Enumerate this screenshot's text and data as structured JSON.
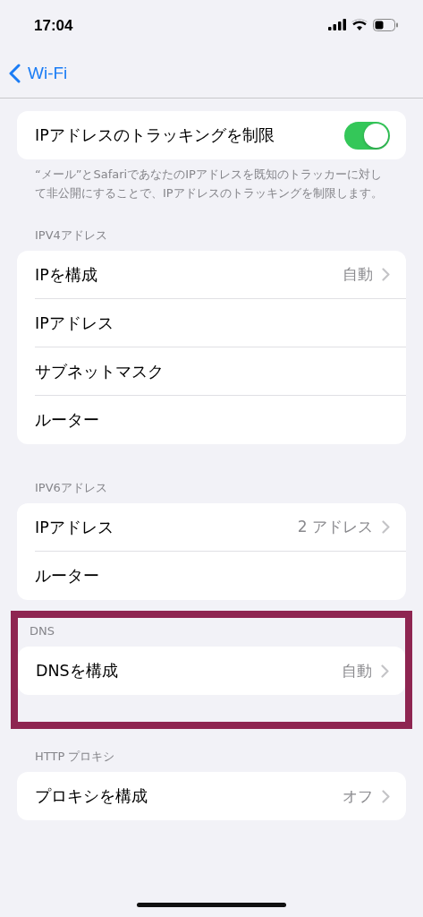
{
  "status_bar": {
    "time": "17:04"
  },
  "nav": {
    "back_label": "Wi-Fi"
  },
  "sections": [
    {
      "highlighted": false,
      "rows": [
        {
          "kind": "toggle",
          "label": "IPアドレスのトラッキングを制限",
          "on": true
        }
      ],
      "footer": "“メール”とSafariであなたのIPアドレスを既知のトラッカーに対して非公開にすることで、IPアドレスのトラッキングを制限します。"
    },
    {
      "highlighted": false,
      "header": "IPV4アドレス",
      "rows": [
        {
          "kind": "detail",
          "label": "IPを構成",
          "value": "自動"
        },
        {
          "kind": "plain",
          "label": "IPアドレス"
        },
        {
          "kind": "plain",
          "label": "サブネットマスク"
        },
        {
          "kind": "plain",
          "label": "ルーター"
        }
      ]
    },
    {
      "highlighted": false,
      "header": "IPV6アドレス",
      "rows": [
        {
          "kind": "detail",
          "label": "IPアドレス",
          "value": "2 アドレス"
        },
        {
          "kind": "plain",
          "label": "ルーター"
        }
      ]
    },
    {
      "highlighted": true,
      "header": "DNS",
      "rows": [
        {
          "kind": "detail",
          "label": "DNSを構成",
          "value": "自動"
        }
      ]
    },
    {
      "highlighted": false,
      "header": "HTTP プロキシ",
      "rows": [
        {
          "kind": "detail",
          "label": "プロキシを構成",
          "value": "オフ"
        }
      ]
    }
  ]
}
